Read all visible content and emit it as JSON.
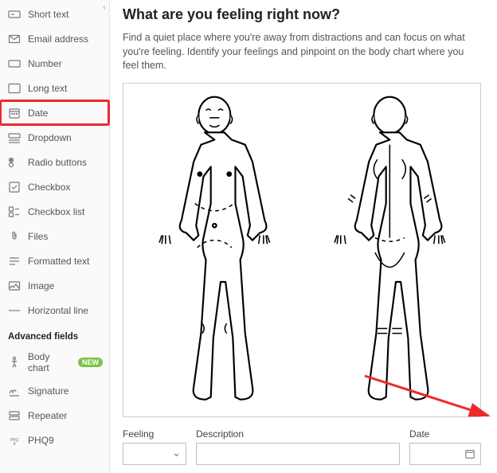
{
  "sidebar": {
    "items": [
      {
        "label": "Short text",
        "icon": "short-text-icon"
      },
      {
        "label": "Email address",
        "icon": "email-icon"
      },
      {
        "label": "Number",
        "icon": "number-icon"
      },
      {
        "label": "Long text",
        "icon": "long-text-icon"
      },
      {
        "label": "Date",
        "icon": "date-icon",
        "highlighted": true
      },
      {
        "label": "Dropdown",
        "icon": "dropdown-icon"
      },
      {
        "label": "Radio buttons",
        "icon": "radio-icon"
      },
      {
        "label": "Checkbox",
        "icon": "checkbox-icon"
      },
      {
        "label": "Checkbox list",
        "icon": "checkbox-list-icon"
      },
      {
        "label": "Files",
        "icon": "files-icon"
      },
      {
        "label": "Formatted text",
        "icon": "formatted-text-icon"
      },
      {
        "label": "Image",
        "icon": "image-icon"
      },
      {
        "label": "Horizontal line",
        "icon": "horizontal-line-icon"
      }
    ],
    "advanced_heading": "Advanced fields",
    "advanced": [
      {
        "label": "Body chart",
        "icon": "body-chart-icon",
        "badge": "NEW"
      },
      {
        "label": "Signature",
        "icon": "signature-icon"
      },
      {
        "label": "Repeater",
        "icon": "repeater-icon"
      },
      {
        "label": "PHQ9",
        "icon": "phq9-icon"
      }
    ]
  },
  "main": {
    "title": "What are you feeling right now?",
    "instructions": "Find a quiet place where you're away from distractions and can focus on what you're feeling. Identify your feelings and pinpoint on the body chart where you feel them.",
    "fields": {
      "feeling_label": "Feeling",
      "description_label": "Description",
      "date_label": "Date"
    }
  },
  "annotation": {
    "arrow_color": "#ec2a2a",
    "highlight_color": "#ec2a2a"
  }
}
